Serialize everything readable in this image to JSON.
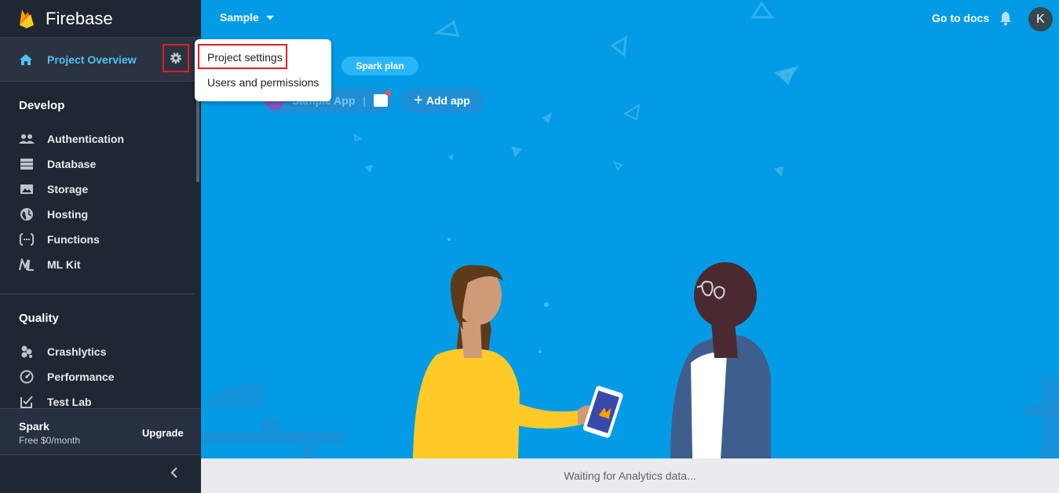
{
  "app": {
    "name": "Firebase"
  },
  "sidebar": {
    "overview_label": "Project Overview",
    "develop": {
      "title": "Develop",
      "items": [
        {
          "label": "Authentication",
          "icon": "people-icon"
        },
        {
          "label": "Database",
          "icon": "database-icon"
        },
        {
          "label": "Storage",
          "icon": "storage-icon"
        },
        {
          "label": "Hosting",
          "icon": "globe-icon"
        },
        {
          "label": "Functions",
          "icon": "functions-icon"
        },
        {
          "label": "ML Kit",
          "icon": "ml-kit-icon"
        }
      ]
    },
    "quality": {
      "title": "Quality",
      "items": [
        {
          "label": "Crashlytics",
          "icon": "crashlytics-icon"
        },
        {
          "label": "Performance",
          "icon": "performance-icon"
        },
        {
          "label": "Test Lab",
          "icon": "test-lab-icon"
        }
      ]
    },
    "plan": {
      "name": "Spark",
      "price": "Free $0/month",
      "upgrade_label": "Upgrade"
    }
  },
  "header": {
    "project_name": "Sample",
    "docs_label": "Go to docs",
    "avatar_initial": "K"
  },
  "main": {
    "plan_chip": "Spark plan",
    "app_chip": "Sample App",
    "add_app_label": "Add app",
    "status": "Waiting for Analytics data..."
  },
  "menu": {
    "items": [
      {
        "label": "Project settings"
      },
      {
        "label": "Users and permissions"
      }
    ]
  },
  "colors": {
    "sidebar_bg": "#1f2733",
    "accent": "#4fc3f7",
    "main_bg": "#039be5",
    "highlight_box": "#e51c23"
  }
}
